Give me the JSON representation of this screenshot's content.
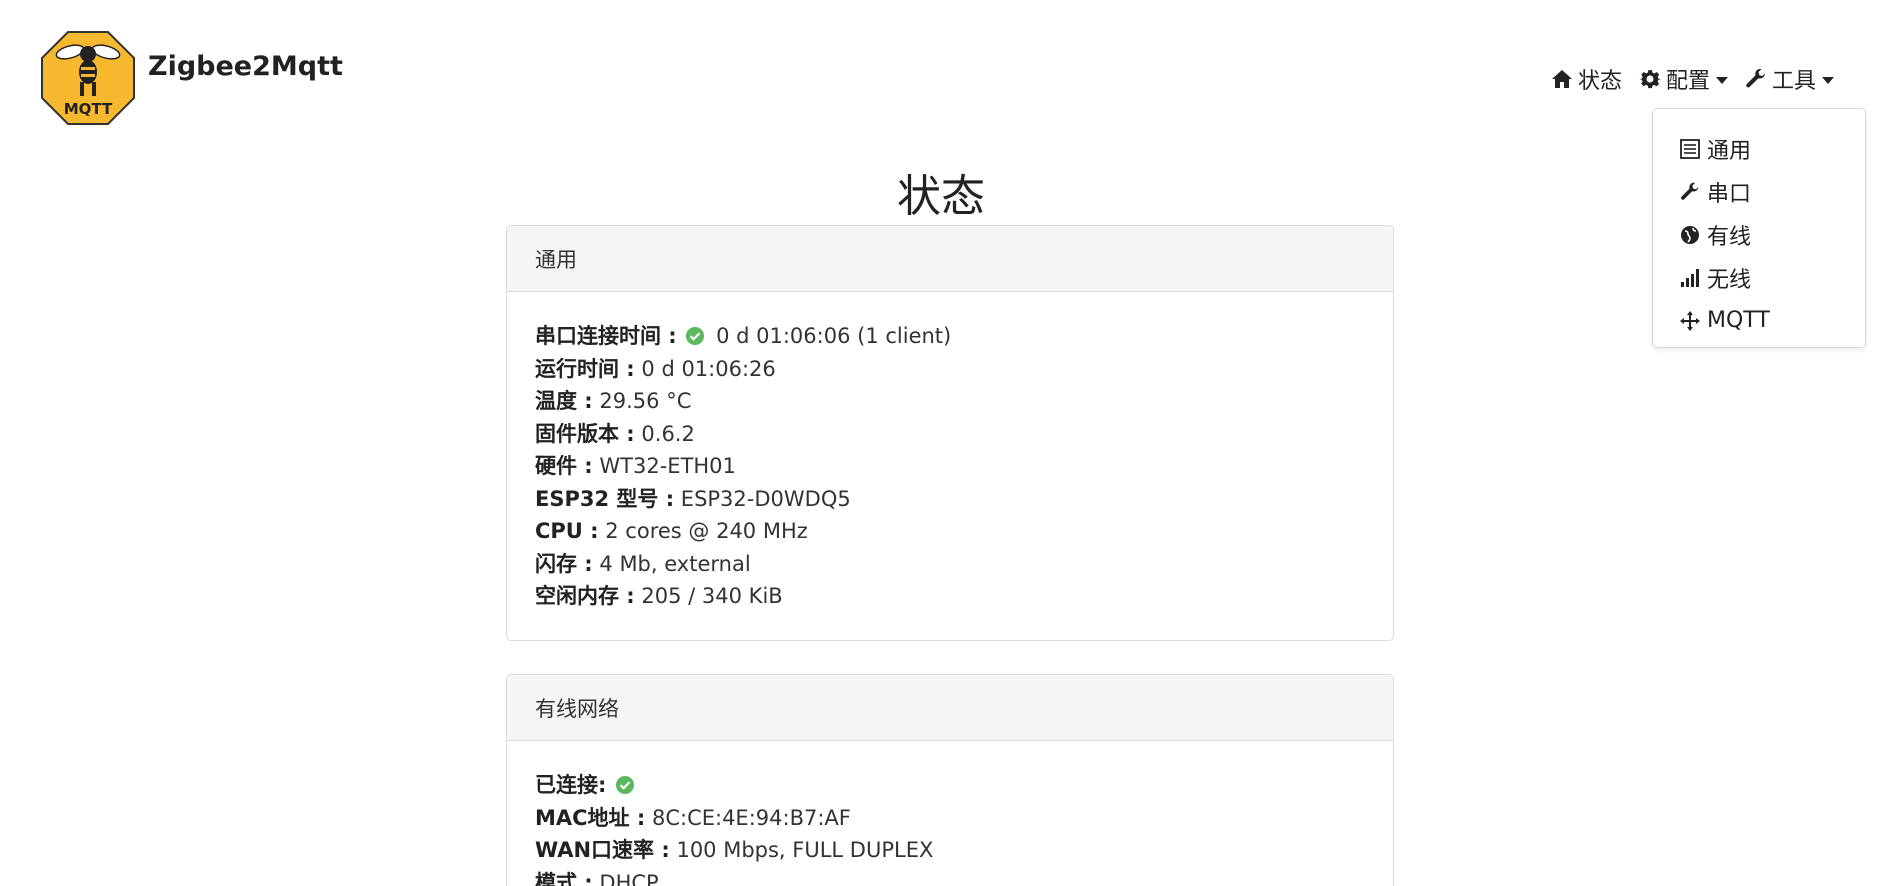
{
  "brand": {
    "name": "Zigbee2Mqtt",
    "logo_text": "MQTT"
  },
  "nav": {
    "status": "状态",
    "config": "配置",
    "tools": "工具"
  },
  "dropdown": {
    "items": [
      "通用",
      "串口",
      "有线",
      "无线",
      "MQTT"
    ]
  },
  "page_title": "状态",
  "general": {
    "heading": "通用",
    "rows": [
      {
        "label": "串口连接时间 :",
        "value": "0 d 01:06:06 (1 client)",
        "ok": true
      },
      {
        "label": "运行时间 :",
        "value": "0 d 01:06:26"
      },
      {
        "label": "温度 :",
        "value": "29.56 °C"
      },
      {
        "label": "固件版本 :",
        "value": "0.6.2"
      },
      {
        "label": "硬件 :",
        "value": "WT32-ETH01"
      },
      {
        "label": "ESP32 型号 :",
        "value": "ESP32-D0WDQ5"
      },
      {
        "label": "CPU :",
        "value": "2 cores @ 240 MHz"
      },
      {
        "label": "闪存 :",
        "value": "4 Mb, external"
      },
      {
        "label": "空闲内存 :",
        "value": "205 / 340 KiB"
      }
    ]
  },
  "wired": {
    "heading": "有线网络",
    "rows": [
      {
        "label": "已连接:",
        "value": "",
        "ok": true
      },
      {
        "label": "MAC地址 :",
        "value": "8C:CE:4E:94:B7:AF"
      },
      {
        "label": "WAN口速率 :",
        "value": "100 Mbps, FULL DUPLEX"
      },
      {
        "label": "模式 :",
        "value": "DHCP"
      }
    ]
  },
  "colors": {
    "ok_green": "#5cb85c",
    "logo_yellow": "#f5b82e"
  }
}
